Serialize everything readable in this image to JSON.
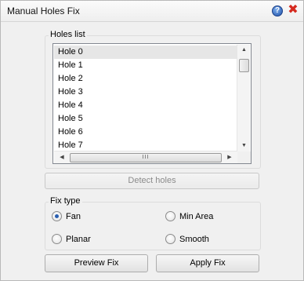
{
  "window": {
    "title": "Manual Holes Fix",
    "help_glyph": "?",
    "close_glyph": "✖"
  },
  "holes_group": {
    "label": "Holes list",
    "items": [
      "Hole 0",
      "Hole 1",
      "Hole 2",
      "Hole 3",
      "Hole 4",
      "Hole 5",
      "Hole 6",
      "Hole 7"
    ],
    "selected_index": 0
  },
  "detect_button": {
    "label": "Detect holes",
    "enabled": false
  },
  "fix_type_group": {
    "label": "Fix type",
    "options": [
      {
        "label": "Fan",
        "checked": true
      },
      {
        "label": "Min Area",
        "checked": false
      },
      {
        "label": "Planar",
        "checked": false
      },
      {
        "label": "Smooth",
        "checked": false
      }
    ]
  },
  "buttons": {
    "preview_label": "Preview Fix",
    "apply_label": "Apply Fix"
  },
  "icons": {
    "help": "help-icon",
    "close": "close-icon",
    "scroll_up": "▲",
    "scroll_down": "▼",
    "scroll_left": "◀",
    "scroll_right": "▶",
    "scroll_grip": "III"
  },
  "colors": {
    "close": "#d52a1f",
    "help": "#1c4fa8",
    "radio_dot": "#2a5fb0"
  }
}
